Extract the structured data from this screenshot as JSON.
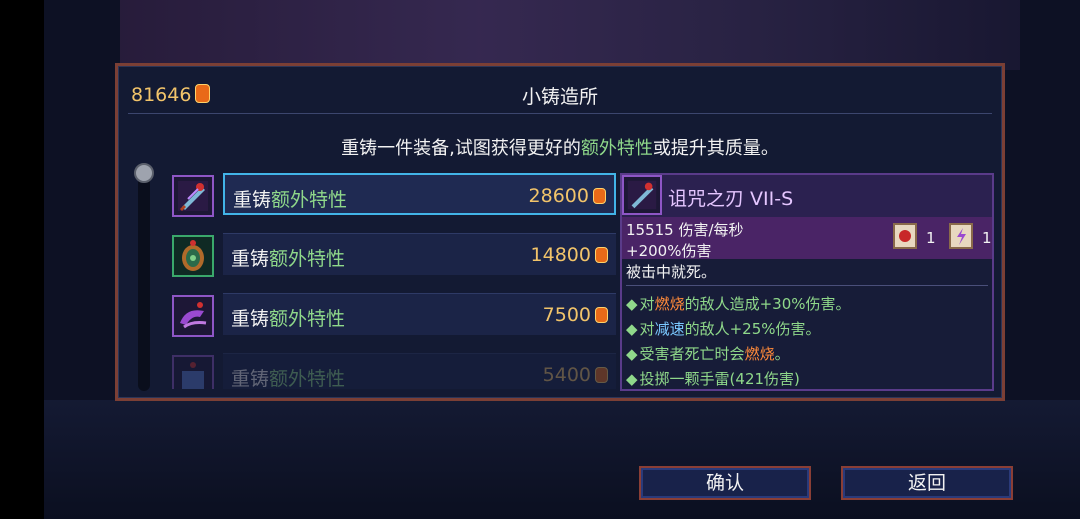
{
  "header": {
    "gold": "81646",
    "title": "小铸造所"
  },
  "description": {
    "pre": "重铸一件装备,试图获得更好的",
    "highlight1": "额外特性",
    "mid": "或提升其质量。"
  },
  "rows": [
    {
      "label_white": "重铸",
      "label_green": "额外特性",
      "price": "28600",
      "icon": "cursed-sword-icon",
      "selected": true
    },
    {
      "label_white": "重铸",
      "label_green": "额外特性",
      "price": "14800",
      "icon": "amulet-icon",
      "selected": false
    },
    {
      "label_white": "重铸",
      "label_green": "额外特性",
      "price": "7500",
      "icon": "creature-weapon-icon",
      "selected": false
    },
    {
      "label_white": "重铸",
      "label_green": "额外特性",
      "price": "5400",
      "icon": "trap-icon",
      "selected": false
    }
  ],
  "detail": {
    "name": "诅咒之刃  VII-S",
    "dps": "15515 伤害/每秒",
    "bonus": "+200%伤害",
    "note": "被击中就死。",
    "scroll1_count": "1",
    "scroll2_count": "1",
    "affixes": [
      {
        "a": "对",
        "b": "燃烧",
        "c": "的敌人造成+30%伤害。",
        "color": "orange"
      },
      {
        "a": "对",
        "b": "减速",
        "c": "的敌人+25%伤害。",
        "color": "blue"
      },
      {
        "a": "受害者死亡时会",
        "b": "燃烧",
        "c": "。",
        "color": "orange"
      },
      {
        "a": "投掷一颗手雷(421伤害)",
        "b": "",
        "c": "",
        "color": ""
      }
    ]
  },
  "buttons": {
    "confirm": "确认",
    "back": "返回"
  },
  "colors": {
    "gold": "#f2c46a",
    "green": "#8fd88a",
    "selected_border": "#42b4e8",
    "panel_border": "#7b3f35"
  }
}
